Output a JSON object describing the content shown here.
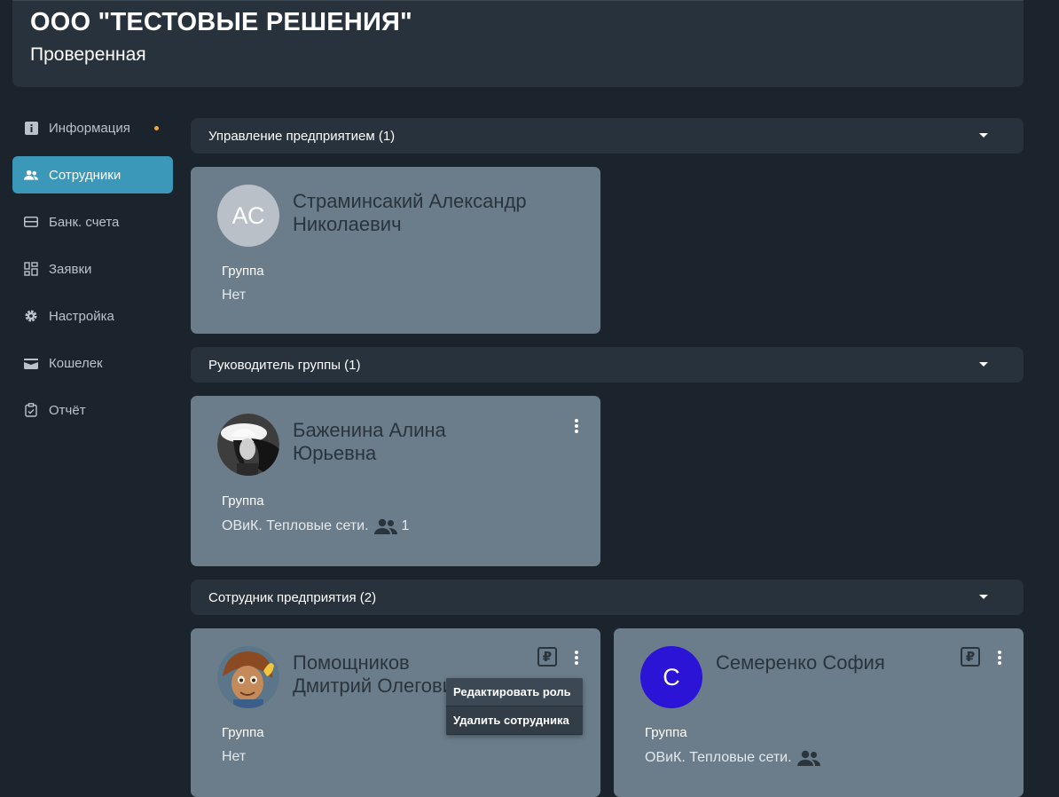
{
  "header": {
    "company": "ООО \"ТЕСТОВЫЕ РЕШЕНИЯ\"",
    "status": "Проверенная"
  },
  "sidebar": {
    "items": [
      {
        "label": "Информация",
        "icon": "info-icon"
      },
      {
        "label": "Сотрудники",
        "icon": "users-icon",
        "active": true
      },
      {
        "label": "Банк. счета",
        "icon": "card-icon"
      },
      {
        "label": "Заявки",
        "icon": "dashboard-icon"
      },
      {
        "label": "Настройка",
        "icon": "gear-icon"
      },
      {
        "label": "Кошелек",
        "icon": "wallet-icon"
      },
      {
        "label": "Отчёт",
        "icon": "clipboard-icon"
      }
    ]
  },
  "sections": [
    {
      "title": "Управление предприятием (1)",
      "cards": [
        {
          "initials": "АС",
          "name_line1": "Страминсакий Александр",
          "name_line2": "Николаевич",
          "group_label": "Группа",
          "group_value": "Нет"
        }
      ]
    },
    {
      "title": "Руководитель группы (1)",
      "cards": [
        {
          "name_line1": "Баженина Алина",
          "name_line2": "Юрьевна",
          "group_label": "Группа",
          "group_value": "ОВиК. Тепловые сети.",
          "group_count": "1"
        }
      ]
    },
    {
      "title": "Сотрудник предприятия (2)",
      "cards": [
        {
          "name_line1": "Помощников",
          "name_line2": "Дмитрий Олегович",
          "group_label": "Группа",
          "group_value": "Нет",
          "ruble": "₽"
        },
        {
          "initials": "С",
          "name_line1": "Семеренко София",
          "group_label": "Группа",
          "group_value": "ОВиК. Тепловые сети.",
          "ruble": "₽"
        }
      ]
    }
  ],
  "context_menu": {
    "edit_role": "Редактировать роль",
    "delete_employee": "Удалить сотрудника"
  },
  "colors": {
    "accent": "#3c98b9",
    "card": "#6b7c8a",
    "background": "#1b242c",
    "notification_dot": "#f2a93b",
    "avatar_c": "#2c14d6",
    "avatar_ac": "#b9c0c8"
  }
}
